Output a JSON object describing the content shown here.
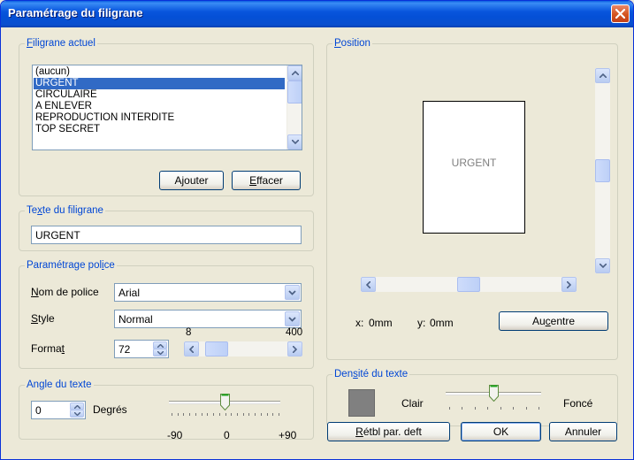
{
  "window": {
    "title": "Paramétrage du filigrane"
  },
  "current": {
    "legend_prefix": "F",
    "legend_rest": "iligrane actuel",
    "items": [
      "(aucun)",
      "URGENT",
      "CIRCULAIRE",
      "A ENLEVER",
      "REPRODUCTION INTERDITE",
      "TOP SECRET"
    ],
    "selected_index": 1,
    "add_label": "Ajouter",
    "delete_prefix": "E",
    "delete_rest": "ffacer"
  },
  "text_group": {
    "legend_pre": "Te",
    "legend_key": "x",
    "legend_post": "te du filigrane",
    "value": "URGENT"
  },
  "font": {
    "legend_pre": "Paramétrage pol",
    "legend_key": "i",
    "legend_post": "ce",
    "name_key": "N",
    "name_rest": "om de police",
    "name_value": "Arial",
    "style_key": "S",
    "style_rest": "tyle",
    "style_value": "Normal",
    "size_pre": "Forma",
    "size_key": "t",
    "size_value": "72",
    "size_min": "8",
    "size_max": "400"
  },
  "angle": {
    "legend": "Angle du texte",
    "value": "0",
    "unit": "Degrés",
    "min": "-90",
    "mid": "0",
    "max": "+90"
  },
  "position": {
    "legend_key": "P",
    "legend_rest": "osition",
    "preview_text": "URGENT",
    "x_label": "x:",
    "x_value": "0mm",
    "y_label": "y:",
    "y_value": "0mm",
    "center_pre": "Au ",
    "center_key": "c",
    "center_rest": "entre"
  },
  "density": {
    "legend_pre": "Den",
    "legend_key": "s",
    "legend_post": "ité du texte",
    "light": "Clair",
    "dark": "Foncé",
    "swatch_color": "#808080"
  },
  "footer": {
    "reset_key": "R",
    "reset_rest": "étbl par. deft",
    "ok": "OK",
    "cancel": "Annuler"
  }
}
